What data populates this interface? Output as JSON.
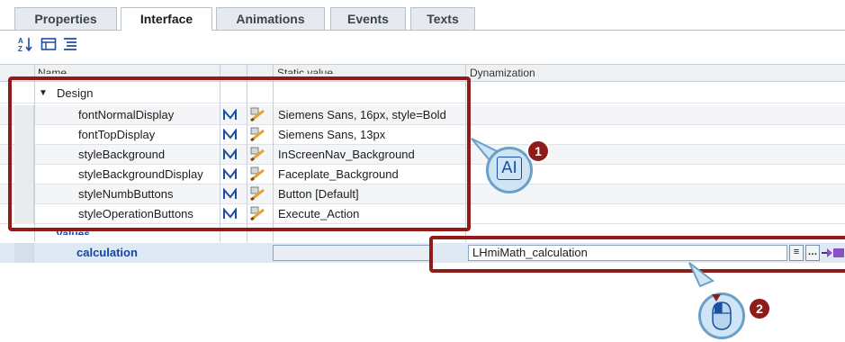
{
  "tabs": [
    {
      "label": "Properties",
      "active": false
    },
    {
      "label": "Interface",
      "active": true
    },
    {
      "label": "Animations",
      "active": false
    },
    {
      "label": "Events",
      "active": false
    },
    {
      "label": "Texts",
      "active": false
    }
  ],
  "toolbar": {
    "icons": [
      "sort-az-icon",
      "grid-icon",
      "list-icon"
    ]
  },
  "columns": {
    "name": "Name",
    "static_value": "Static value",
    "dynamization": "Dynamization"
  },
  "group": {
    "label": "Design",
    "rows": [
      {
        "name": "fontNormalDisplay",
        "value": "Siemens Sans, 16px, style=Bold"
      },
      {
        "name": "fontTopDisplay",
        "value": "Siemens Sans, 13px"
      },
      {
        "name": "styleBackground",
        "value": "InScreenNav_Background"
      },
      {
        "name": "styleBackgroundDisplay",
        "value": "Faceplate_Background"
      },
      {
        "name": "styleNumbButtons",
        "value": "Button [Default]"
      },
      {
        "name": "styleOperationButtons",
        "value": "Execute_Action"
      }
    ]
  },
  "values_group": {
    "label": "Values"
  },
  "calculation": {
    "name": "calculation",
    "static_value": "",
    "dynamization": "LHmiMath_calculation"
  },
  "callouts": [
    {
      "number": "1",
      "icon": "text-cursor-icon",
      "glyph": "AI"
    },
    {
      "number": "2",
      "icon": "mouse-icon"
    }
  ],
  "colors": {
    "highlight_border": "#8f1b1b",
    "callout_fill": "#cfe5f5",
    "selected_row": "#dfe9f4",
    "link_blue": "#1446a0"
  }
}
